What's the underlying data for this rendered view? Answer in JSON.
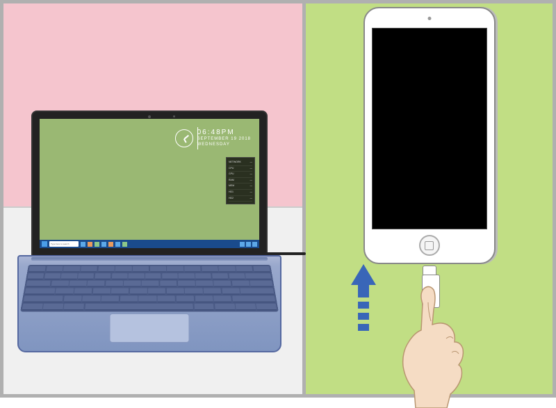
{
  "laptop": {
    "clock": {
      "time": "06:48PM",
      "date": "SEPTEMBER 19 2018",
      "day": "WEDNESDAY"
    },
    "search_placeholder": "Type here to search",
    "widget_lines": [
      "NETWORK",
      "CPU",
      "GPU",
      "RAM",
      "MEM",
      "HD1",
      "HD2"
    ]
  },
  "colors": {
    "left_bg": "#f5c5ce",
    "right_bg": "#c1de84",
    "arrow": "#3966b8",
    "wallpaper": "#9ab873"
  }
}
